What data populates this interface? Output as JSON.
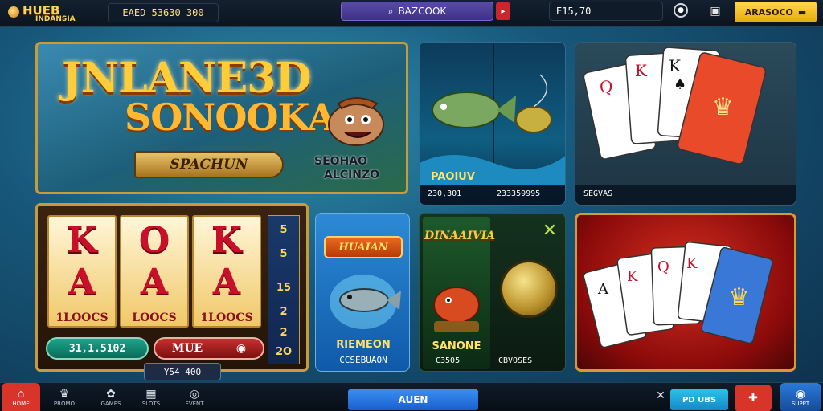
{
  "header": {
    "logo_main": "HUEB",
    "logo_sub": "INDANSIA",
    "balance": "EAED 53630 300",
    "search_text": "BAZCOOK",
    "coins": "E15,70",
    "login_label": "ARASOCO",
    "icons": {
      "search": "search-icon",
      "alert": "alert-icon",
      "settings": "settings-icon",
      "gift": "gift-icon",
      "wallet": "wallet-icon"
    }
  },
  "hero": {
    "title_line1": "JNLANE3D",
    "title_line2": "SONOOKA",
    "button_label": "SPACHUN",
    "sub_line1": "SEOHAO",
    "sub_line2": "ALCINZO"
  },
  "games": {
    "fish": {
      "label": "PAOIUV",
      "stat1": "230,301",
      "stat2": "233359995"
    },
    "cards": {
      "label": "SEGVAS"
    },
    "slot": {
      "reel_top": "K",
      "reel_mid": [
        "O",
        "A",
        "A"
      ],
      "reel_top_row": [
        "K",
        "O",
        "K"
      ],
      "reel_labels": [
        "1LOOCS",
        "LOOCS",
        "1LOOCS"
      ],
      "paytable": [
        "5",
        "5",
        "15",
        "2",
        "2",
        "2O"
      ],
      "win_value": "31,1.5102",
      "bet_label": "MUE",
      "total": "Y54 40O"
    },
    "fish2": {
      "title": "HUAIAN",
      "name": "RIEMEON",
      "sub": "CCSEBUAON"
    },
    "dragon": {
      "title": "DINAAIVIA",
      "name": "SANONE",
      "sub1": "C3505",
      "sub2": "CBVOSES"
    },
    "poker": {}
  },
  "footer": {
    "nav": [
      {
        "label": "HOME",
        "icon": "home-icon"
      },
      {
        "label": "PROMO",
        "icon": "crown-icon"
      },
      {
        "label": "GAMES",
        "icon": "gear-icon"
      },
      {
        "label": "SLOTS",
        "icon": "slot-icon"
      },
      {
        "label": "EVENT",
        "icon": "globe-icon"
      }
    ],
    "deposit_label": "AUEN",
    "chat_label": "PD UBS",
    "help_label": "SUPPT"
  },
  "colors": {
    "accent_gold": "#c79a3c",
    "brand_yellow": "#ffd94a",
    "search_purple": "#4b3c98",
    "deposit_blue": "#2a7ae8",
    "home_red": "#d8342a"
  }
}
